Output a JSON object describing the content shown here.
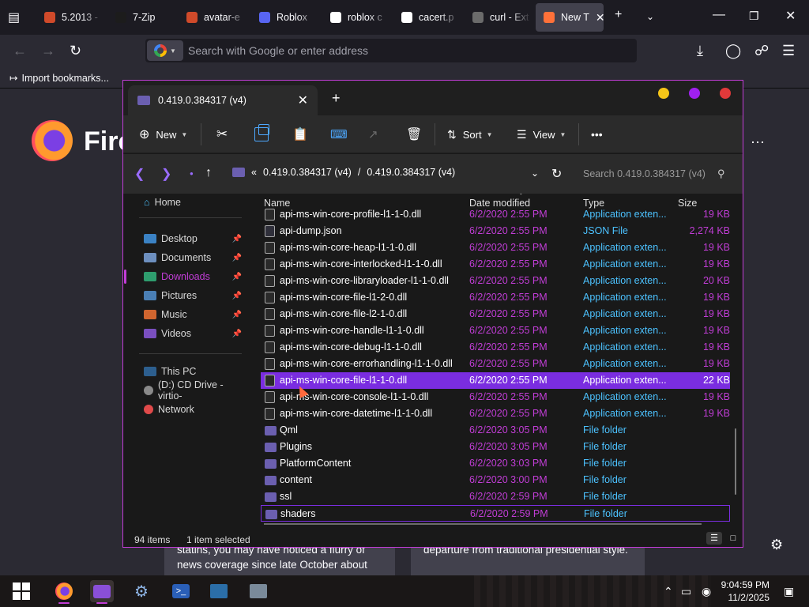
{
  "browser": {
    "tabs": [
      {
        "title": "5.2013 -",
        "color": "#d04a2a"
      },
      {
        "title": "7-Zip",
        "color": "#1c1c1c"
      },
      {
        "title": "avatar-e",
        "color": "#d04a2a"
      },
      {
        "title": "Roblox",
        "color": "#5865f2"
      },
      {
        "title": "roblox c",
        "color": "#ffffff"
      },
      {
        "title": "cacert.p",
        "color": "#ffffff"
      },
      {
        "title": "curl - Ext",
        "color": "#6b6b6b"
      },
      {
        "title": "New T",
        "color": "#ff7139"
      }
    ],
    "url_placeholder": "Search with Google or enter address",
    "bookmark_import": "Import bookmarks...",
    "wordmark": "Fire",
    "stories": [
      {
        "text": "statins, you may have noticed a flurry of news coverage since late October about an..."
      },
      {
        "text": "departure from traditional presidential style."
      }
    ]
  },
  "explorer": {
    "tab_title": "0.419.0.384317 (v4)",
    "toolbar": {
      "new": "New",
      "sort": "Sort",
      "view": "View",
      "more": "•••"
    },
    "breadcrumb": {
      "chevrons": "«",
      "segment1": "0.419.0.384317 (v4)",
      "sep": "/",
      "segment2": "0.419.0.384317 (v4)"
    },
    "search_placeholder": "Search 0.419.0.384317 (v4)",
    "nav": {
      "home": "Home",
      "desktop": "Desktop",
      "documents": "Documents",
      "downloads": "Downloads",
      "pictures": "Pictures",
      "music": "Music",
      "videos": "Videos",
      "this_pc": "This PC",
      "cd_drive": "(D:) CD Drive - virtio-",
      "network": "Network"
    },
    "columns": {
      "name": "Name",
      "date": "Date modified",
      "type": "Type",
      "size": "Size"
    },
    "files": [
      {
        "name": "api-ms-win-core-profile-l1-1-0.dll",
        "date": "6/2/2020 2:55 PM",
        "type": "Application exten...",
        "size": "19 KB",
        "icon": "dll"
      },
      {
        "name": "api-dump.json",
        "date": "6/2/2020 2:55 PM",
        "type": "JSON File",
        "size": "2,274 KB",
        "icon": "json"
      },
      {
        "name": "api-ms-win-core-heap-l1-1-0.dll",
        "date": "6/2/2020 2:55 PM",
        "type": "Application exten...",
        "size": "19 KB",
        "icon": "dll"
      },
      {
        "name": "api-ms-win-core-interlocked-l1-1-0.dll",
        "date": "6/2/2020 2:55 PM",
        "type": "Application exten...",
        "size": "19 KB",
        "icon": "dll"
      },
      {
        "name": "api-ms-win-core-libraryloader-l1-1-0.dll",
        "date": "6/2/2020 2:55 PM",
        "type": "Application exten...",
        "size": "20 KB",
        "icon": "dll"
      },
      {
        "name": "api-ms-win-core-file-l1-2-0.dll",
        "date": "6/2/2020 2:55 PM",
        "type": "Application exten...",
        "size": "19 KB",
        "icon": "dll"
      },
      {
        "name": "api-ms-win-core-file-l2-1-0.dll",
        "date": "6/2/2020 2:55 PM",
        "type": "Application exten...",
        "size": "19 KB",
        "icon": "dll"
      },
      {
        "name": "api-ms-win-core-handle-l1-1-0.dll",
        "date": "6/2/2020 2:55 PM",
        "type": "Application exten...",
        "size": "19 KB",
        "icon": "dll"
      },
      {
        "name": "api-ms-win-core-debug-l1-1-0.dll",
        "date": "6/2/2020 2:55 PM",
        "type": "Application exten...",
        "size": "19 KB",
        "icon": "dll"
      },
      {
        "name": "api-ms-win-core-errorhandling-l1-1-0.dll",
        "date": "6/2/2020 2:55 PM",
        "type": "Application exten...",
        "size": "19 KB",
        "icon": "dll"
      },
      {
        "name": "api-ms-win-core-file-l1-1-0.dll",
        "date": "6/2/2020 2:55 PM",
        "type": "Application exten...",
        "size": "22 KB",
        "icon": "dll",
        "selected": true
      },
      {
        "name": "api-ms-win-core-console-l1-1-0.dll",
        "date": "6/2/2020 2:55 PM",
        "type": "Application exten...",
        "size": "19 KB",
        "icon": "dll"
      },
      {
        "name": "api-ms-win-core-datetime-l1-1-0.dll",
        "date": "6/2/2020 2:55 PM",
        "type": "Application exten...",
        "size": "19 KB",
        "icon": "dll"
      },
      {
        "name": "Qml",
        "date": "6/2/2020 3:05 PM",
        "type": "File folder",
        "size": "",
        "icon": "folder"
      },
      {
        "name": "Plugins",
        "date": "6/2/2020 3:05 PM",
        "type": "File folder",
        "size": "",
        "icon": "folder"
      },
      {
        "name": "PlatformContent",
        "date": "6/2/2020 3:03 PM",
        "type": "File folder",
        "size": "",
        "icon": "folder"
      },
      {
        "name": "content",
        "date": "6/2/2020 3:00 PM",
        "type": "File folder",
        "size": "",
        "icon": "folder"
      },
      {
        "name": "ssl",
        "date": "6/2/2020 2:59 PM",
        "type": "File folder",
        "size": "",
        "icon": "folder"
      },
      {
        "name": "shaders",
        "date": "6/2/2020 2:59 PM",
        "type": "File folder",
        "size": "",
        "icon": "folder",
        "focused": true
      }
    ],
    "status": {
      "items": "94 items",
      "selected": "1 item selected"
    }
  },
  "taskbar": {
    "time": "9:04:59 PM",
    "date": "11/2/2025"
  },
  "colors": {
    "accent": "#c13dd6",
    "selection": "#7a2de0",
    "type_text": "#4cc2ff"
  }
}
